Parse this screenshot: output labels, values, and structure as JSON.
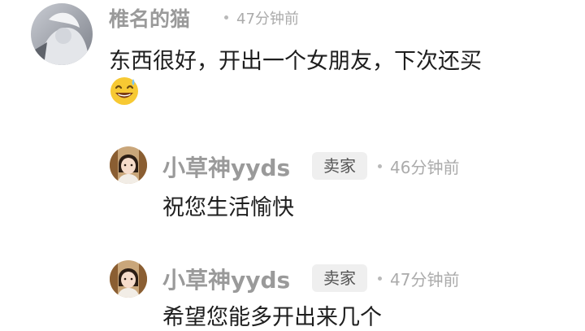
{
  "comments": [
    {
      "username": "椎名的猫",
      "time": "47分钟前",
      "text": "东西很好，开出一个女朋友，下次还买",
      "emoji": "grinning-sweat-emoji"
    }
  ],
  "replies": [
    {
      "username": "小草神yyds",
      "badge": "卖家",
      "time": "46分钟前",
      "text": "祝您生活愉快"
    },
    {
      "username": "小草神yyds",
      "badge": "卖家",
      "time": "47分钟前",
      "text": "希望您能多开出来几个"
    }
  ],
  "colors": {
    "username": "#9a9a9a",
    "time": "#ababab",
    "text": "#1e1e1e",
    "badge_bg": "#efefef"
  }
}
